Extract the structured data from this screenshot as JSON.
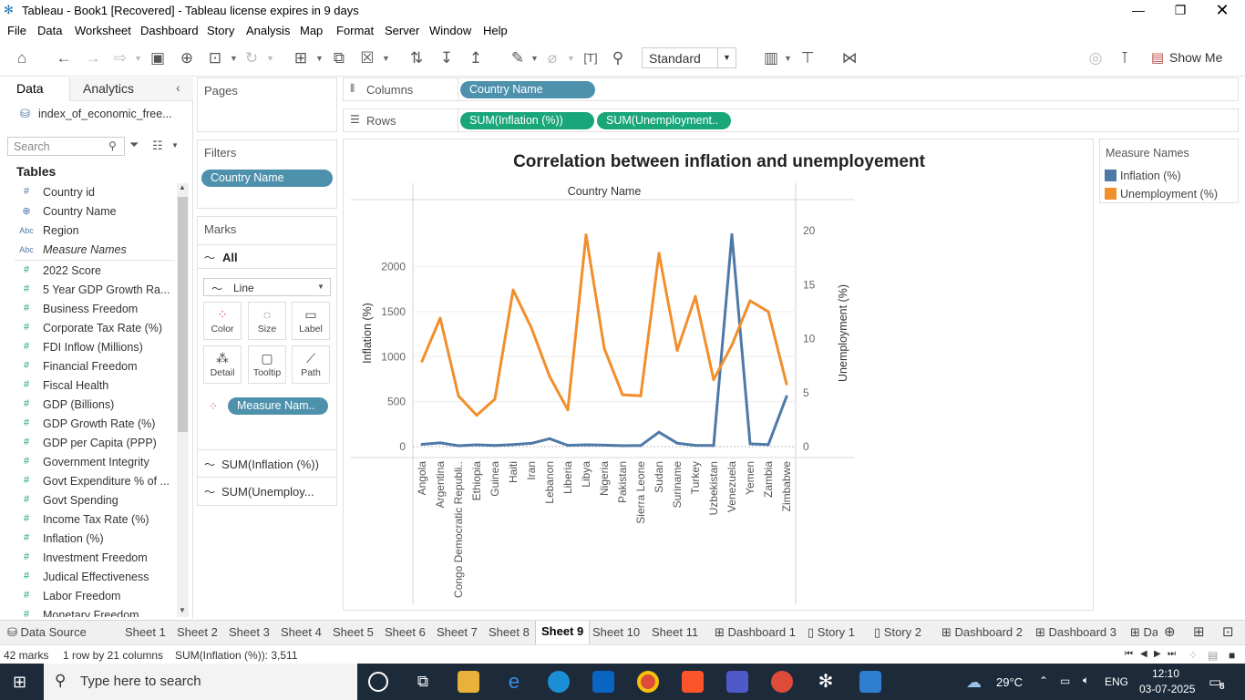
{
  "window": {
    "title": "Tableau - Book1 [Recovered] - Tableau license expires in 9 days"
  },
  "menu": [
    "File",
    "Data",
    "Worksheet",
    "Dashboard",
    "Story",
    "Analysis",
    "Map",
    "Format",
    "Server",
    "Window",
    "Help"
  ],
  "toolbar": {
    "fit_mode": "Standard",
    "show_me": "Show Me"
  },
  "data_pane": {
    "tab_data": "Data",
    "tab_analytics": "Analytics",
    "datasource": "index_of_economic_free...",
    "search_placeholder": "Search",
    "tables_header": "Tables",
    "fields": [
      {
        "icon": "#",
        "label": "Country id",
        "italic": false
      },
      {
        "icon": "globe",
        "label": "Country Name",
        "italic": false
      },
      {
        "icon": "Abc",
        "label": "Region",
        "italic": false
      },
      {
        "icon": "Abc",
        "label": "Measure Names",
        "italic": true
      },
      {
        "icon": "#",
        "label": "2022 Score",
        "italic": false
      },
      {
        "icon": "#",
        "label": "5 Year GDP Growth Ra...",
        "italic": false
      },
      {
        "icon": "#",
        "label": "Business Freedom",
        "italic": false
      },
      {
        "icon": "#",
        "label": "Corporate Tax Rate (%)",
        "italic": false
      },
      {
        "icon": "#",
        "label": "FDI Inflow (Millions)",
        "italic": false
      },
      {
        "icon": "#",
        "label": "Financial Freedom",
        "italic": false
      },
      {
        "icon": "#",
        "label": "Fiscal Health",
        "italic": false
      },
      {
        "icon": "#",
        "label": "GDP (Billions)",
        "italic": false
      },
      {
        "icon": "#",
        "label": "GDP Growth Rate (%)",
        "italic": false
      },
      {
        "icon": "#",
        "label": "GDP per Capita (PPP)",
        "italic": false
      },
      {
        "icon": "#",
        "label": "Government Integrity",
        "italic": false
      },
      {
        "icon": "#",
        "label": "Govt Expenditure % of ...",
        "italic": false
      },
      {
        "icon": "#",
        "label": "Govt Spending",
        "italic": false
      },
      {
        "icon": "#",
        "label": "Income Tax Rate (%)",
        "italic": false
      },
      {
        "icon": "#",
        "label": "Inflation (%)",
        "italic": false
      },
      {
        "icon": "#",
        "label": "Investment Freedom",
        "italic": false
      },
      {
        "icon": "#",
        "label": "Judical Effectiveness",
        "italic": false
      },
      {
        "icon": "#",
        "label": "Labor Freedom",
        "italic": false
      },
      {
        "icon": "#",
        "label": "Monetary Freedom",
        "italic": false
      }
    ]
  },
  "pages": {
    "header": "Pages"
  },
  "filters": {
    "header": "Filters",
    "pill": "Country Name"
  },
  "marks": {
    "header": "Marks",
    "all": "All",
    "type": "Line",
    "buttons": [
      "Color",
      "Size",
      "Label",
      "Detail",
      "Tooltip",
      "Path"
    ],
    "color_pill": "Measure Nam..",
    "sub1": "SUM(Inflation (%))",
    "sub2": "SUM(Unemploy..."
  },
  "shelves": {
    "columns_label": "Columns",
    "columns_pill": "Country Name",
    "rows_label": "Rows",
    "rows_pill1": "SUM(Inflation (%))",
    "rows_pill2": "SUM(Unemployment.."
  },
  "legend": {
    "title": "Measure Names",
    "items": [
      {
        "label": "Inflation (%)",
        "color": "#4e79a7"
      },
      {
        "label": "Unemployment (%)",
        "color": "#f28e2b"
      }
    ]
  },
  "chart_data": {
    "type": "line",
    "title": "Correlation between inflation and unemployement",
    "header": "Country Name",
    "categories": [
      "Angola",
      "Argentina",
      "Congo Democratic Republi..",
      "Ethiopia",
      "Guinea",
      "Haiti",
      "Iran",
      "Lebanon",
      "Liberia",
      "Libya",
      "Nigeria",
      "Pakistan",
      "Sierra Leone",
      "Sudan",
      "Suriname",
      "Turkey",
      "Uzbekistan",
      "Venezuela",
      "Yemen",
      "Zambia",
      "Zimbabwe"
    ],
    "series": [
      {
        "name": "Inflation (%)",
        "axis": "left",
        "color": "#4e79a7",
        "values": [
          25,
          42,
          10,
          20,
          12,
          22,
          36,
          88,
          14,
          20,
          16,
          10,
          12,
          160,
          38,
          14,
          12,
          2355,
          30,
          22,
          557
        ]
      },
      {
        "name": "Unemployment (%)",
        "axis": "right",
        "color": "#f28e2b",
        "values": [
          7.9,
          11.9,
          4.7,
          2.9,
          4.4,
          14.5,
          11.0,
          6.5,
          3.4,
          19.6,
          9.1,
          4.8,
          4.7,
          17.9,
          8.9,
          13.9,
          6.2,
          9.4,
          13.5,
          12.5,
          5.8
        ]
      }
    ],
    "ylabel_left": "Inflation (%)",
    "ylabel_right": "Unemployment (%)",
    "y_left_ticks": [
      0,
      500,
      1000,
      1500,
      2000
    ],
    "y_right_ticks": [
      0,
      5,
      10,
      15,
      20
    ],
    "ylim_left": [
      0,
      2400
    ],
    "ylim_right": [
      0,
      20
    ]
  },
  "sheet_tabs": {
    "datasource": "Data Source",
    "tabs": [
      "Sheet 1",
      "Sheet 2",
      "Sheet 3",
      "Sheet 4",
      "Sheet 5",
      "Sheet 6",
      "Sheet 7",
      "Sheet 8",
      "Sheet 9",
      "Sheet 10",
      "Sheet 11",
      "Dashboard 1",
      "Story 1",
      "Story 2",
      "Dashboard 2",
      "Dashboard 3",
      "Da"
    ],
    "active": "Sheet 9"
  },
  "status": {
    "marks": "42 marks",
    "dims": "1 row by 21 columns",
    "sum": "SUM(Inflation (%)): 3,511"
  },
  "taskbar": {
    "search_placeholder": "Type here to search",
    "weather": "29°C",
    "lang": "ENG",
    "time": "12:10",
    "date": "03-07-2025",
    "notif": "8"
  }
}
